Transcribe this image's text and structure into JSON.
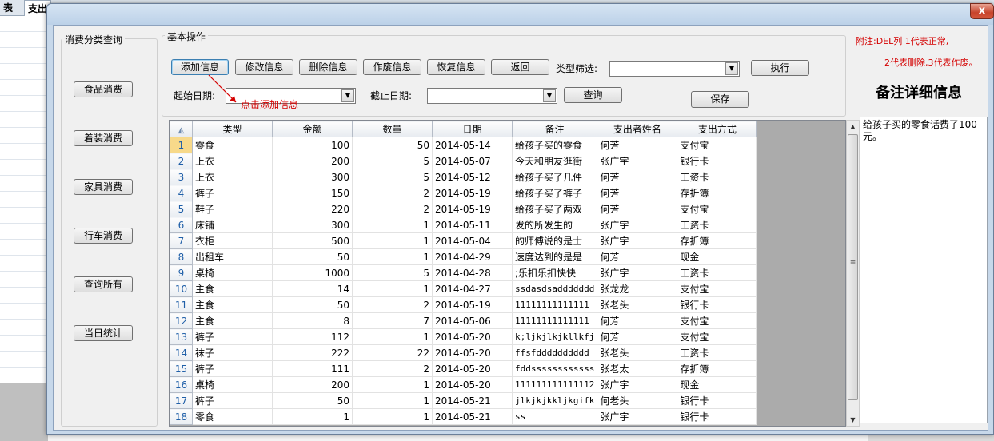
{
  "background": {
    "tab1": "表",
    "tab2": "支出"
  },
  "window": {
    "close_label": "x"
  },
  "sidebar": {
    "title": "消费分类查询",
    "buttons": [
      "食品消费",
      "着装消费",
      "家具消费",
      "行车消费",
      "查询所有",
      "当日统计"
    ]
  },
  "basic_ops": {
    "title": "基本操作",
    "buttons": [
      "添加信息",
      "修改信息",
      "删除信息",
      "作废信息",
      "恢复信息",
      "返回"
    ],
    "type_filter_label": "类型筛选:",
    "type_filter_value": "",
    "execute_label": "执行",
    "start_date_label": "起始日期:",
    "start_date_value": "",
    "end_date_label": "截止日期:",
    "end_date_value": "",
    "query_label": "查询",
    "save_label": "保存",
    "hint": "点击添加信息"
  },
  "notes": {
    "line1": "附注:DEL列  1代表正常,",
    "line2": "2代表删除,3代表作废。"
  },
  "detail": {
    "title": "备注详细信息",
    "content": "给孩子买的零食话费了100元。"
  },
  "grid": {
    "columns": [
      "类型",
      "金额",
      "数量",
      "日期",
      "备注",
      "支出者姓名",
      "支出方式"
    ],
    "rows": [
      [
        "零食",
        "100",
        "50",
        "2014-05-14",
        "给孩子买的零食",
        "何芳",
        "支付宝"
      ],
      [
        "上衣",
        "200",
        "5",
        "2014-05-07",
        "今天和朋友逛街",
        "张广宇",
        "银行卡"
      ],
      [
        "上衣",
        "300",
        "5",
        "2014-05-12",
        "给孩子买了几件",
        "何芳",
        "工资卡"
      ],
      [
        "裤子",
        "150",
        "2",
        "2014-05-19",
        "给孩子买了裤子",
        "何芳",
        "存折簿"
      ],
      [
        "鞋子",
        "220",
        "2",
        "2014-05-19",
        "给孩子买了两双",
        "何芳",
        "支付宝"
      ],
      [
        "床铺",
        "300",
        "1",
        "2014-05-11",
        "发的所发生的",
        "张广宇",
        "工资卡"
      ],
      [
        "衣柜",
        "500",
        "1",
        "2014-05-04",
        "的师傅说的是士",
        "张广宇",
        "存折簿"
      ],
      [
        "出租车",
        "50",
        "1",
        "2014-04-29",
        "速度达到的是是",
        "何芳",
        "现金"
      ],
      [
        "桌椅",
        "1000",
        "5",
        "2014-04-28",
        ";乐扣乐扣快快",
        "张广宇",
        "工资卡"
      ],
      [
        "主食",
        "14",
        "1",
        "2014-04-27",
        "ssdasdsaddddddd",
        "张龙龙",
        "支付宝"
      ],
      [
        "主食",
        "50",
        "2",
        "2014-05-19",
        "11111111111111",
        "张老头",
        "银行卡"
      ],
      [
        "主食",
        "8",
        "7",
        "2014-05-06",
        "11111111111111",
        "何芳",
        "支付宝"
      ],
      [
        "裤子",
        "112",
        "1",
        "2014-05-20",
        "k;ljkjlkjkllkfj",
        "何芳",
        "支付宝"
      ],
      [
        "袜子",
        "222",
        "22",
        "2014-05-20",
        "ffsfdddddddddd",
        "张老头",
        "工资卡"
      ],
      [
        "裤子",
        "111",
        "2",
        "2014-05-20",
        "fddssssssssssss",
        "张老太",
        "存折簿"
      ],
      [
        "桌椅",
        "200",
        "1",
        "2014-05-20",
        "111111111111112",
        "张广宇",
        "现金"
      ],
      [
        "裤子",
        "50",
        "1",
        "2014-05-21",
        "jlkjkjkkljkgifk",
        "何老头",
        "银行卡"
      ],
      [
        "零食",
        "1",
        "1",
        "2014-05-21",
        "ss",
        "张广宇",
        "银行卡"
      ]
    ]
  },
  "colors": {
    "accent_red": "#d40000",
    "selected_row_header": "#f7d98a"
  }
}
